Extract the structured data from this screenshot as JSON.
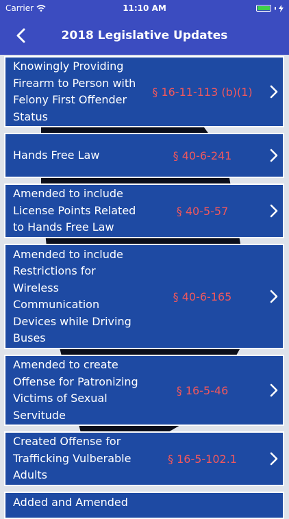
{
  "status_bar": {
    "carrier": "Carrier",
    "time": "11:10 AM",
    "icons": [
      "wifi-icon",
      "battery-icon",
      "charging-bolt-icon"
    ]
  },
  "nav": {
    "title": "2018 Legislative Updates",
    "back_icon": "chevron-left-icon"
  },
  "colors": {
    "nav_bg": "#3b4cc0",
    "row_bg": "#1e4aa3",
    "code_text": "#f0585d",
    "map_silhouette": "#0b0e1a"
  },
  "items": [
    {
      "label": "Knowingly Providing Firearm to Person with Felony First Offender Status",
      "code": "§ 16-11-113 (b)(1)"
    },
    {
      "label": "Hands Free Law",
      "code": "§ 40-6-241"
    },
    {
      "label": "Amended to include License Points Related to Hands Free Law",
      "code": "§ 40-5-57"
    },
    {
      "label": "Amended to include Restrictions for Wireless Communication Devices while Driving Buses",
      "code": "§ 40-6-165"
    },
    {
      "label": "Amended to create Offense for Patronizing Victims of Sexual Servitude",
      "code": "§ 16-5-46"
    },
    {
      "label": "Created Offense for Trafficking Vulberable Adults",
      "code": "§ 16-5-102.1"
    },
    {
      "label": "Added and Amended",
      "code": ""
    }
  ]
}
